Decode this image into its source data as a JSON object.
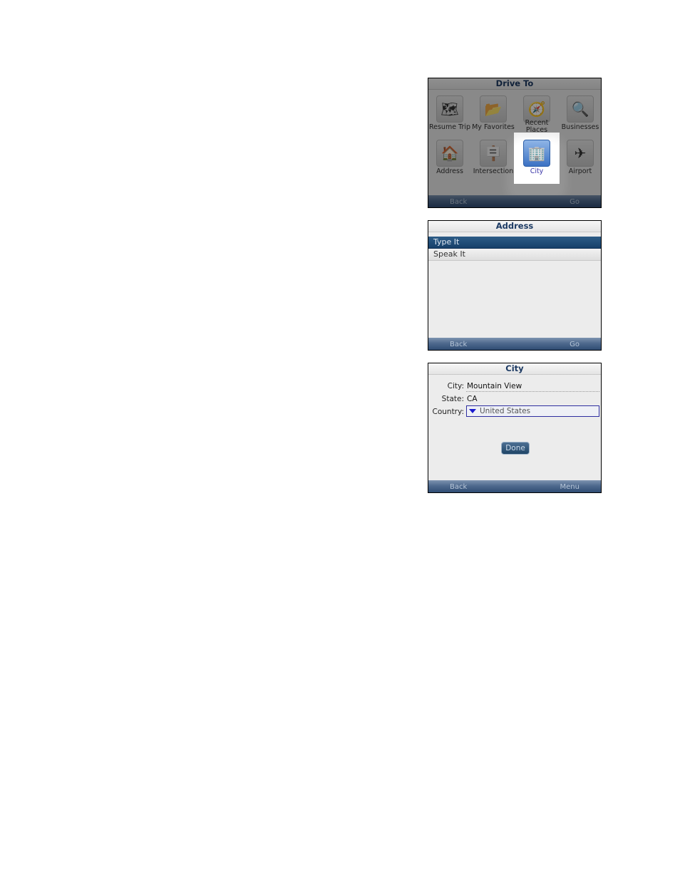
{
  "screens": {
    "drive_to": {
      "title": "Drive To",
      "items": [
        {
          "label": "Resume Trip",
          "icon": "map-arrow-icon",
          "selected": false
        },
        {
          "label": "My Favorites",
          "icon": "folder-heart-icon",
          "selected": false
        },
        {
          "label": "Recent Places",
          "icon": "recent-map-icon",
          "selected": false
        },
        {
          "label": "Businesses",
          "icon": "magnifier-map-icon",
          "selected": false
        },
        {
          "label": "Address",
          "icon": "house-icon",
          "selected": false
        },
        {
          "label": "Intersection",
          "icon": "signpost-icon",
          "selected": false
        },
        {
          "label": "City",
          "icon": "city-building-icon",
          "selected": true
        },
        {
          "label": "Airport",
          "icon": "airplane-icon",
          "selected": false
        }
      ],
      "softkeys": {
        "left": "Back",
        "right": "Go"
      }
    },
    "address": {
      "title": "Address",
      "items": [
        {
          "label": "Type It",
          "selected": true
        },
        {
          "label": "Speak It",
          "selected": false
        }
      ],
      "softkeys": {
        "left": "Back",
        "right": "Go"
      }
    },
    "city": {
      "title": "City",
      "fields": {
        "city": {
          "label": "City:",
          "value": "Mountain View"
        },
        "state": {
          "label": "State:",
          "value": "CA"
        },
        "country": {
          "label": "Country:",
          "value": "United States"
        }
      },
      "done_label": "Done",
      "softkeys": {
        "left": "Back",
        "right": "Menu"
      }
    }
  },
  "colors": {
    "selection": "#1f4a73",
    "softkey_bar": "#3d5a80",
    "title_text": "#1c3a63",
    "selected_label": "#3a36a8"
  }
}
